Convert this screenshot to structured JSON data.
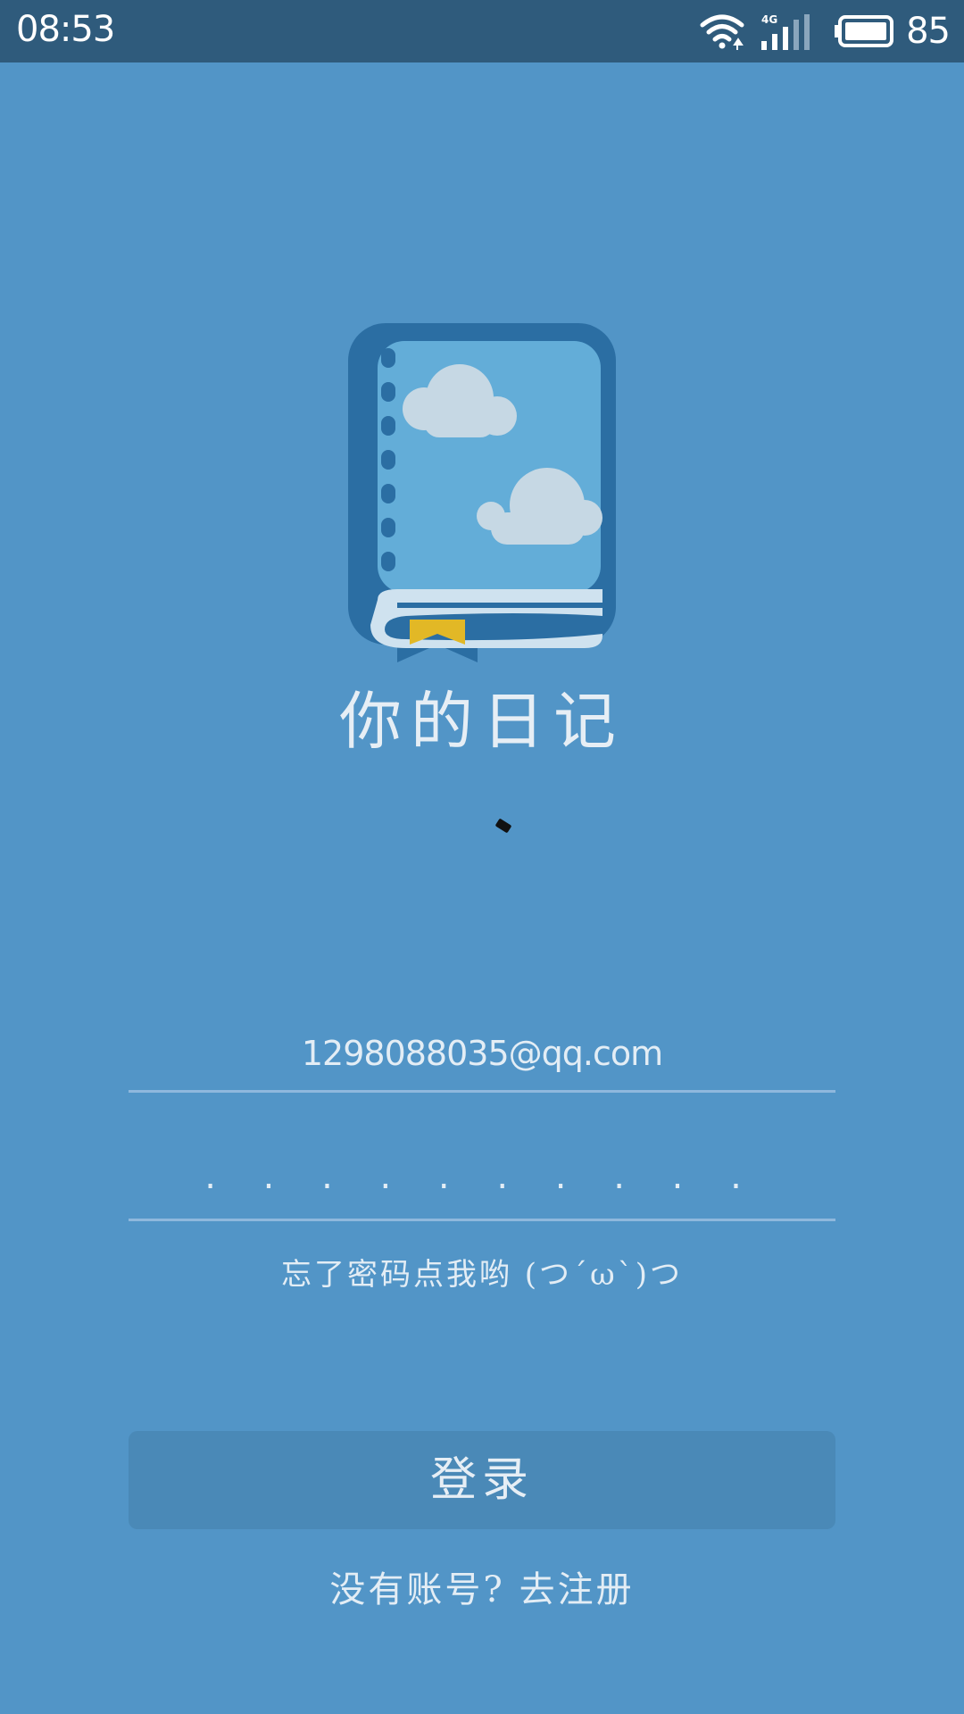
{
  "status_bar": {
    "time": "08:53",
    "network": "4G",
    "battery": "85",
    "icons": [
      "wifi-icon",
      "signal-icon",
      "battery-icon"
    ]
  },
  "app": {
    "logo": "diary-book-icon",
    "title": "你的日记"
  },
  "form": {
    "email_value": "1298088035@qq.com",
    "password_value": ". . . . . . . . . .",
    "forgot_label": "忘了密码点我哟 (つ´ω`)つ",
    "login_label": "登录",
    "register_label": "没有账号? 去注册"
  },
  "colors": {
    "background": "#5295c7",
    "status_bar": "#2f5b7c",
    "button": "#4a89b7",
    "text": "#e3edf5",
    "book_cover": "#2b6ea3",
    "book_page": "#63add8",
    "bookmark": "#e2b826"
  }
}
